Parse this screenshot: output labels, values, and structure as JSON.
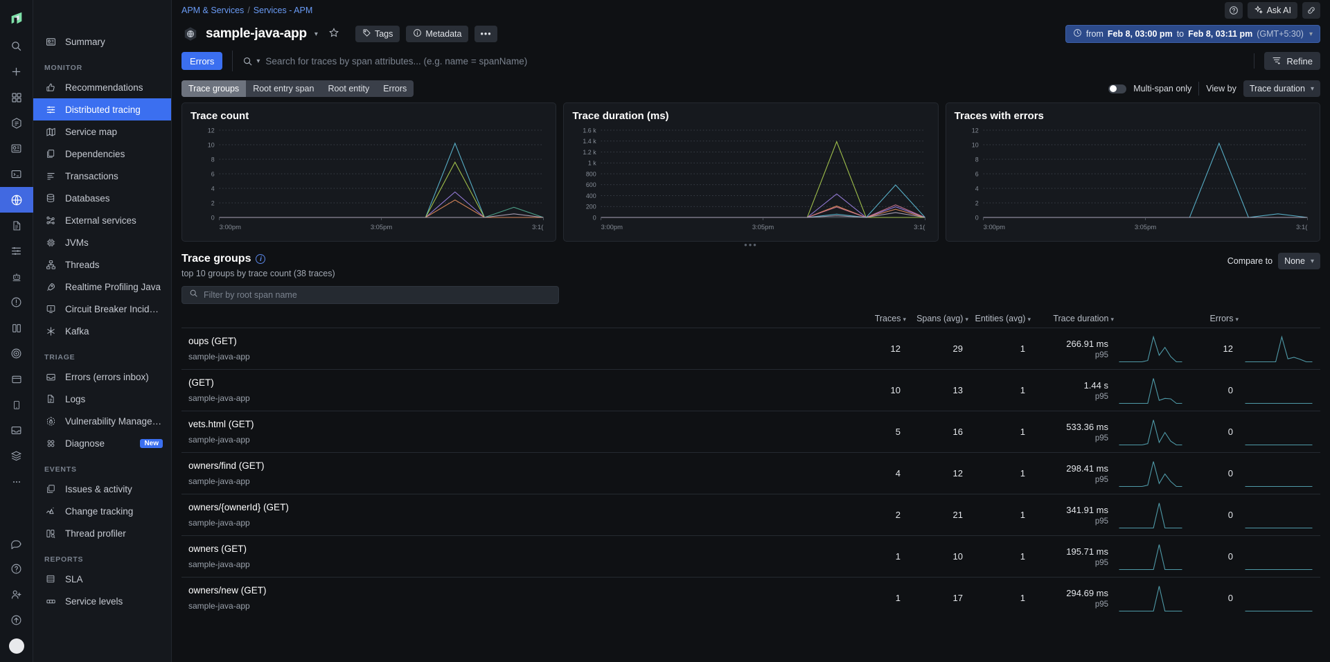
{
  "rail": {
    "logo": "datadog-logo",
    "icons": [
      "search-icon",
      "add-icon",
      "dashboards-icon",
      "watchdog-icon",
      "apm-summary-icon",
      "terminal-icon",
      "globe-icon",
      "logs-doc-icon",
      "traces-icon",
      "bot-icon",
      "alert-icon",
      "infra-icon",
      "rum-icon",
      "browser-icon",
      "mobile-icon",
      "inbox-icon",
      "database-stack-icon",
      "more-dots-icon"
    ],
    "active_index": 6,
    "bottom_icons": [
      "chat-icon",
      "help-circle-icon",
      "user-add-icon",
      "upgrade-icon"
    ]
  },
  "breadcrumb": {
    "parent": "APM & Services",
    "separator": "/",
    "current": "Services - APM"
  },
  "header": {
    "service_name": "sample-java-app",
    "tags_label": "Tags",
    "metadata_label": "Metadata",
    "more_label": "•••",
    "ask_ai_label": "Ask AI",
    "time_from": "from",
    "time_from_value": "Feb 8, 03:00 pm",
    "time_to": "to",
    "time_to_value": "Feb 8, 03:11 pm",
    "timezone": "(GMT+5:30)"
  },
  "sidebar": {
    "top": [
      {
        "label": "Summary",
        "icon": "summary-icon"
      }
    ],
    "sections": [
      {
        "title": "MONITOR",
        "items": [
          {
            "label": "Recommendations",
            "icon": "thumbs-up-icon"
          },
          {
            "label": "Distributed tracing",
            "icon": "tracing-icon",
            "active": true
          },
          {
            "label": "Service map",
            "icon": "map-icon"
          },
          {
            "label": "Dependencies",
            "icon": "dependencies-icon"
          },
          {
            "label": "Transactions",
            "icon": "transactions-icon"
          },
          {
            "label": "Databases",
            "icon": "database-icon"
          },
          {
            "label": "External services",
            "icon": "external-services-icon"
          },
          {
            "label": "JVMs",
            "icon": "chip-icon"
          },
          {
            "label": "Threads",
            "icon": "threads-icon"
          },
          {
            "label": "Realtime Profiling Java",
            "icon": "rocket-icon"
          },
          {
            "label": "Circuit Breaker Incidents",
            "icon": "circuit-breaker-icon"
          },
          {
            "label": "Kafka",
            "icon": "kafka-icon"
          }
        ]
      },
      {
        "title": "TRIAGE",
        "items": [
          {
            "label": "Errors (errors inbox)",
            "icon": "errors-inbox-icon"
          },
          {
            "label": "Logs",
            "icon": "logs-icon"
          },
          {
            "label": "Vulnerability Managem...",
            "icon": "vulnerability-icon"
          },
          {
            "label": "Diagnose",
            "icon": "diagnose-icon",
            "badge": "New"
          }
        ]
      },
      {
        "title": "EVENTS",
        "items": [
          {
            "label": "Issues & activity",
            "icon": "issues-icon"
          },
          {
            "label": "Change tracking",
            "icon": "change-tracking-icon"
          },
          {
            "label": "Thread profiler",
            "icon": "thread-profiler-icon"
          }
        ]
      },
      {
        "title": "REPORTS",
        "items": [
          {
            "label": "SLA",
            "icon": "sla-icon"
          },
          {
            "label": "Service levels",
            "icon": "service-levels-icon"
          }
        ]
      }
    ]
  },
  "search": {
    "errors_button": "Errors",
    "placeholder": "Search for traces by span attributes... (e.g. name = spanName)",
    "value": "",
    "refine_label": "Refine"
  },
  "tabs": {
    "items": [
      "Trace groups",
      "Root entry span",
      "Root entity",
      "Errors"
    ],
    "active": "Trace groups",
    "multi_span_label": "Multi-span only",
    "multi_span_on": false,
    "view_by_label": "View by",
    "view_by_value": "Trace duration"
  },
  "chart_data": [
    {
      "type": "line",
      "title": "Trace count",
      "xlabel": "",
      "ylabel": "",
      "ylim": [
        0,
        12
      ],
      "yticks": [
        0,
        2,
        4,
        6,
        8,
        10,
        12
      ],
      "xticks": [
        "3:00pm",
        "3:05pm",
        "3:1("
      ],
      "grid": true,
      "legend": "none",
      "x": [
        0,
        1,
        2,
        3,
        4,
        5,
        6,
        7,
        8,
        9,
        10,
        11
      ],
      "series": [
        {
          "name": "series-1",
          "color": "#5bb5cf",
          "values": [
            0,
            0,
            0,
            0,
            0,
            0,
            0,
            0,
            10.2,
            0,
            0,
            0
          ]
        },
        {
          "name": "series-2",
          "color": "#a8c94e",
          "values": [
            0,
            0,
            0,
            0,
            0,
            0,
            0,
            0,
            7.6,
            0,
            0,
            0
          ]
        },
        {
          "name": "series-3",
          "color": "#9b7fe0",
          "values": [
            0,
            0,
            0,
            0,
            0,
            0,
            0,
            0,
            3.5,
            0,
            0,
            0
          ]
        },
        {
          "name": "series-4",
          "color": "#e08a5c",
          "values": [
            0,
            0,
            0,
            0,
            0,
            0,
            0,
            0,
            2.4,
            0,
            0,
            0
          ]
        },
        {
          "name": "series-5",
          "color": "#4fa58c",
          "values": [
            0,
            0,
            0,
            0,
            0,
            0,
            0,
            0,
            0,
            0,
            1.4,
            0
          ]
        },
        {
          "name": "series-6",
          "color": "#b0a4b8",
          "values": [
            0,
            0,
            0,
            0,
            0,
            0,
            0,
            0,
            0,
            0,
            0.5,
            0
          ]
        }
      ]
    },
    {
      "type": "line",
      "title": "Trace duration (ms)",
      "xlabel": "",
      "ylabel": "",
      "ylim": [
        0,
        1600
      ],
      "yticks": [
        "0",
        "200",
        "400",
        "600",
        "800",
        "1 k",
        "1.2 k",
        "1.4 k",
        "1.6 k"
      ],
      "xticks": [
        "3:00pm",
        "3:05pm",
        "3:1("
      ],
      "grid": true,
      "legend": "none",
      "x": [
        0,
        1,
        2,
        3,
        4,
        5,
        6,
        7,
        8,
        9,
        10,
        11
      ],
      "series": [
        {
          "name": "series-1",
          "color": "#a8c94e",
          "values": [
            0,
            0,
            0,
            0,
            0,
            0,
            0,
            0,
            1390,
            0,
            0,
            0
          ]
        },
        {
          "name": "series-2",
          "color": "#9b7fe0",
          "values": [
            0,
            0,
            0,
            0,
            0,
            0,
            0,
            0,
            430,
            0,
            195,
            0
          ]
        },
        {
          "name": "series-3",
          "color": "#e08a5c",
          "values": [
            0,
            0,
            0,
            0,
            0,
            0,
            0,
            0,
            210,
            0,
            150,
            0
          ]
        },
        {
          "name": "series-4",
          "color": "#c8748f",
          "values": [
            0,
            0,
            0,
            0,
            0,
            0,
            0,
            0,
            190,
            0,
            230,
            0
          ]
        },
        {
          "name": "series-5",
          "color": "#5bb5cf",
          "values": [
            0,
            0,
            0,
            0,
            0,
            0,
            0,
            0,
            60,
            0,
            595,
            0
          ]
        },
        {
          "name": "series-6",
          "color": "#b0a4b8",
          "values": [
            0,
            0,
            0,
            0,
            0,
            0,
            0,
            0,
            30,
            0,
            90,
            0
          ]
        }
      ]
    },
    {
      "type": "line",
      "title": "Traces with errors",
      "xlabel": "",
      "ylabel": "",
      "ylim": [
        0,
        12
      ],
      "yticks": [
        0,
        2,
        4,
        6,
        8,
        10,
        12
      ],
      "xticks": [
        "3:00pm",
        "3:05pm",
        "3:1("
      ],
      "grid": true,
      "legend": "none",
      "x": [
        0,
        1,
        2,
        3,
        4,
        5,
        6,
        7,
        8,
        9,
        10,
        11
      ],
      "series": [
        {
          "name": "series-1",
          "color": "#5bb5cf",
          "values": [
            0,
            0,
            0,
            0,
            0,
            0,
            0,
            0,
            10.2,
            0,
            0.5,
            0
          ]
        },
        {
          "name": "series-2",
          "color": "#b0a4b8",
          "values": [
            0,
            0,
            0,
            0,
            0,
            0,
            0,
            0,
            0,
            0,
            0,
            0
          ]
        }
      ]
    }
  ],
  "trace_groups": {
    "title": "Trace groups",
    "subtitle": "top 10 groups by trace count (38 traces)",
    "filter_placeholder": "Filter by root span name",
    "filter_value": "",
    "compare_label": "Compare to",
    "compare_value": "None",
    "columns": [
      "Traces",
      "Spans (avg)",
      "Entities (avg)",
      "Trace duration",
      "Errors"
    ],
    "rows": [
      {
        "name": "oups (GET)",
        "service": "sample-java-app",
        "traces": "12",
        "spans": "29",
        "entities": "1",
        "duration": "266.91 ms",
        "percentile": "p95",
        "errors": "12"
      },
      {
        "name": "(GET)",
        "service": "sample-java-app",
        "traces": "10",
        "spans": "13",
        "entities": "1",
        "duration": "1.44 s",
        "percentile": "p95",
        "errors": "0"
      },
      {
        "name": "vets.html (GET)",
        "service": "sample-java-app",
        "traces": "5",
        "spans": "16",
        "entities": "1",
        "duration": "533.36 ms",
        "percentile": "p95",
        "errors": "0"
      },
      {
        "name": "owners/find (GET)",
        "service": "sample-java-app",
        "traces": "4",
        "spans": "12",
        "entities": "1",
        "duration": "298.41 ms",
        "percentile": "p95",
        "errors": "0"
      },
      {
        "name": "owners/{ownerId} (GET)",
        "service": "sample-java-app",
        "traces": "2",
        "spans": "21",
        "entities": "1",
        "duration": "341.91 ms",
        "percentile": "p95",
        "errors": "0"
      },
      {
        "name": "owners (GET)",
        "service": "sample-java-app",
        "traces": "1",
        "spans": "10",
        "entities": "1",
        "duration": "195.71 ms",
        "percentile": "p95",
        "errors": "0"
      },
      {
        "name": "owners/new (GET)",
        "service": "sample-java-app",
        "traces": "1",
        "spans": "17",
        "entities": "1",
        "duration": "294.69 ms",
        "percentile": "p95",
        "errors": "0"
      }
    ]
  },
  "colors": {
    "accent_blue": "#3b6ff0",
    "link_blue": "#6a9bf5",
    "panel_bg": "#16191e",
    "page_bg": "#0f1114",
    "sidebar_bg": "#15181d",
    "teal_spark": "#4f9aa8"
  }
}
